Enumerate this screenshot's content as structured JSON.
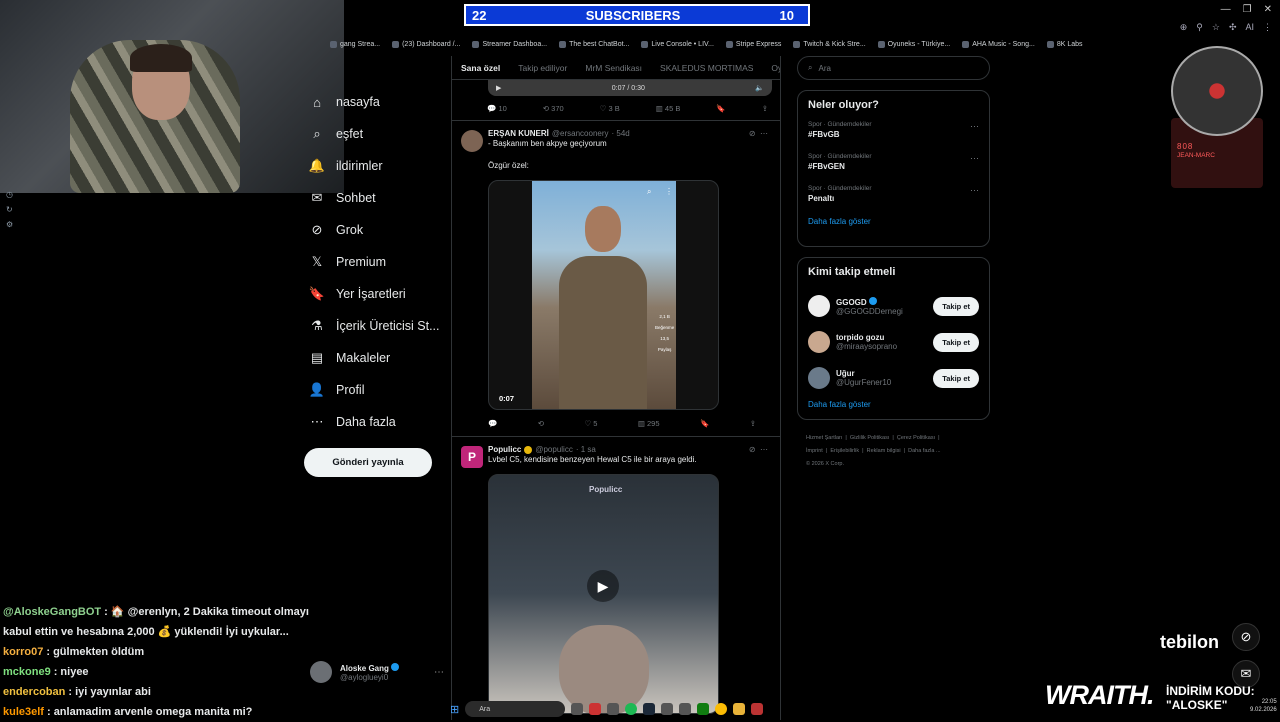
{
  "banner": {
    "left_count": "22",
    "title": "SUBSCRIBERS",
    "right_count": "10"
  },
  "bookmarks": [
    "gang Strea...",
    "(23) Dashboard /...",
    "Streamer Dashboa...",
    "The best ChatBot...",
    "Live Console • LIV...",
    "Stripe Express",
    "Twitch & Kick Stre...",
    "Oyuneks - Türkiye...",
    "AHA Music - Song...",
    "8K Labs"
  ],
  "browser": {
    "ai_label": "AI"
  },
  "nav": {
    "items": [
      {
        "label": "nasayfa",
        "icon": "home-icon",
        "glyph": "⌂"
      },
      {
        "label": "eşfet",
        "icon": "search-icon",
        "glyph": "⌕"
      },
      {
        "label": "ildirimler",
        "icon": "bell-icon",
        "glyph": "🔔"
      },
      {
        "label": "Sohbet",
        "icon": "mail-icon",
        "glyph": "✉"
      },
      {
        "label": "Grok",
        "icon": "grok-icon",
        "glyph": "⊘"
      },
      {
        "label": "Premium",
        "icon": "x-logo-icon",
        "glyph": "𝕏"
      },
      {
        "label": "Yer İşaretleri",
        "icon": "bookmark-icon",
        "glyph": "🔖"
      },
      {
        "label": "İçerik Üreticisi St...",
        "icon": "flask-icon",
        "glyph": "⚗"
      },
      {
        "label": "Makaleler",
        "icon": "article-icon",
        "glyph": "▤"
      },
      {
        "label": "Profil",
        "icon": "profile-icon",
        "glyph": "👤"
      },
      {
        "label": "Daha fazla",
        "icon": "more-icon",
        "glyph": "⋯"
      }
    ],
    "post_button": "Gönderi yayınla"
  },
  "account": {
    "name": "Aloske Gang",
    "handle": "@ayloglueyi0"
  },
  "tabs": [
    "Sana özel",
    "Takip ediliyor",
    "MrM Sendikası",
    "SKALEDUS MORTIMAS",
    "Oyu"
  ],
  "top_tweet_actions": {
    "replies": "10",
    "reposts": "370",
    "likes": "3 B",
    "views": "45 B",
    "video_time": "0:07 / 0:30"
  },
  "tweets": [
    {
      "name": "ERŞAN KUNERİ",
      "handle": "@ersancoonery",
      "time": "· 54d",
      "text1": "- Başkanım ben akpye geçiyorum",
      "text2": "Özgür özel:",
      "video_time": "0:07",
      "video_side": [
        "2,1 B",
        "Beğenme",
        "13,5",
        "Paylaş"
      ],
      "actions": {
        "replies": "",
        "reposts": "",
        "likes": "5",
        "views": "295"
      }
    },
    {
      "name": "Populicc",
      "handle": "@populicc",
      "time": "· 1 sa",
      "text1": "Lvbel C5, kendisine benzeyen Hewal C5 ile bir araya geldi.",
      "watermark": "Populicc"
    }
  ],
  "search": {
    "placeholder": "Ara"
  },
  "trends": {
    "title": "Neler oluyor?",
    "items": [
      {
        "category": "Spor · Gündemdekiler",
        "tag": "#FBvGB"
      },
      {
        "category": "Spor · Gündemdekiler",
        "tag": "#FBvGEN"
      },
      {
        "category": "Spor · Gündemdekiler",
        "tag": "Penaltı"
      }
    ],
    "show_more": "Daha fazla göster"
  },
  "who_to_follow": {
    "title": "Kimi takip etmeli",
    "items": [
      {
        "name": "GGOGD",
        "handle": "@GGOGDDernegi",
        "button": "Takip et",
        "verified": true
      },
      {
        "name": "torpido gozu",
        "handle": "@miraaysoprano",
        "button": "Takip et",
        "verified": false
      },
      {
        "name": "Uğur",
        "handle": "@UgurFener10",
        "button": "Takip et",
        "verified": false
      }
    ],
    "show_more": "Daha fazla göster"
  },
  "footer_links": [
    "Hizmet Şartları",
    "Gizlilik Politikası",
    "Çerez Politikası",
    "İmprint",
    "Erişilebilirlik",
    "Reklam bilgisi",
    "Daha fazla ...",
    "© 2026 X Corp."
  ],
  "music": {
    "title": "808",
    "artist": "JEAN-MARC"
  },
  "chat": [
    {
      "user": "@AloskeGangBOT",
      "color": "#8fd18f",
      "msg": ": 🏠 @erenlyn, 2 Dakika timeout olmayı kabul ettin ve hesabına 2,000 💰 yüklendi! İyi uykular..."
    },
    {
      "user": "korro07",
      "color": "#f5b041",
      "msg": ": gülmekten öldüm"
    },
    {
      "user": "mckone9",
      "color": "#7fe07f",
      "msg": ": niyee"
    },
    {
      "user": "endercoban",
      "color": "#f0c040",
      "msg": ": iyi yayınlar abi"
    },
    {
      "user": "kule3elf",
      "color": "#ff9900",
      "msg": ": anlamadim arvenle omega manita mi?"
    }
  ],
  "sponsor": {
    "brand": "tebilon",
    "brand2": "WRAITH.",
    "discount_label": "İNDİRİM KODU:",
    "discount_code": "\"ALOSKE\""
  },
  "taskbar": {
    "search_placeholder": "Ara"
  },
  "clock": {
    "time": "22:05",
    "date": "9.02.2026"
  },
  "colors": {
    "accent": "#1d9bf0",
    "banner_bg": "#0b3ad6"
  }
}
